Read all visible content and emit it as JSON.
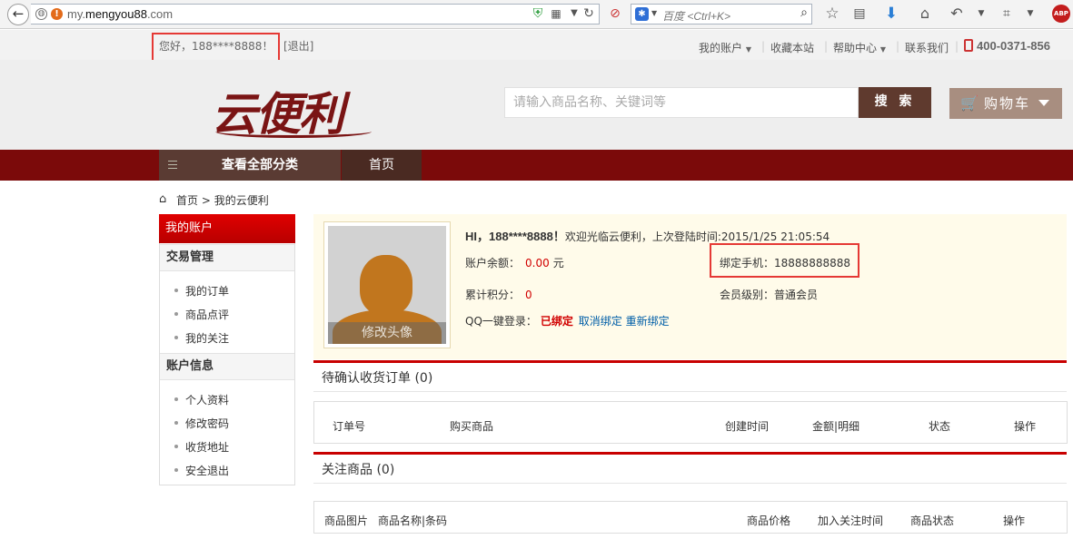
{
  "browser": {
    "back_glyph": "←",
    "url_domain": "my.",
    "url_host": "mengyou88",
    "url_tld": ".com",
    "search_placeholder": "百度 <Ctrl+K>",
    "abp_label": "ABP"
  },
  "topbar": {
    "greeting": "您好，188****8888！",
    "logout": "[退出]",
    "links": [
      "我的账户",
      "收藏本站",
      "帮助中心",
      "联系我们"
    ],
    "phone": "400-0371-856"
  },
  "header": {
    "logo_text": "云便利",
    "search_placeholder": "请输入商品名称、关键词等",
    "search_button": "搜 索",
    "cart_label": "购物车"
  },
  "nav": {
    "all_categories": "查看全部分类",
    "home": "首页"
  },
  "breadcrumb": {
    "home": "首页",
    "sep": ">",
    "current": "我的云便利"
  },
  "sidebar": {
    "title": "我的账户",
    "groups": [
      {
        "title": "交易管理",
        "items": [
          "我的订单",
          "商品点评",
          "我的关注"
        ]
      },
      {
        "title": "账户信息",
        "items": [
          "个人资料",
          "修改密码",
          "收货地址",
          "安全退出"
        ]
      }
    ]
  },
  "profile": {
    "avatar_edit": "修改头像",
    "hi_user": "HI，188****8888！",
    "welcome_text": "欢迎光临云便利，上次登陆时间:2015/1/25 21:05:54",
    "balance_label": "账户余额：",
    "balance_value": "0.00",
    "balance_unit": "元",
    "phone_label": "绑定手机：",
    "phone_value": "18888888888",
    "points_label": "累计积分：",
    "points_value": "0",
    "level_label": "会员级别：",
    "level_value": "普通会员",
    "qq_label": "QQ一键登录：",
    "qq_status": "已绑定",
    "qq_unbind": "取消绑定",
    "qq_rebind": "重新绑定"
  },
  "orders": {
    "title": "待确认收货订单 (0)",
    "columns": [
      "订单号",
      "购买商品",
      "创建时间",
      "金额|明细",
      "状态",
      "操作"
    ]
  },
  "follows": {
    "title": "关注商品 (0)",
    "columns": [
      "商品图片",
      "商品名称|条码",
      "商品价格",
      "加入关注时间",
      "商品状态",
      "操作"
    ]
  },
  "colors": {
    "nav_bg": "#7b0a0a",
    "accent_red": "#d10000",
    "highlight_box": "#e53935",
    "profile_bg": "#fffbea",
    "search_button_bg": "#5f3a2e"
  }
}
